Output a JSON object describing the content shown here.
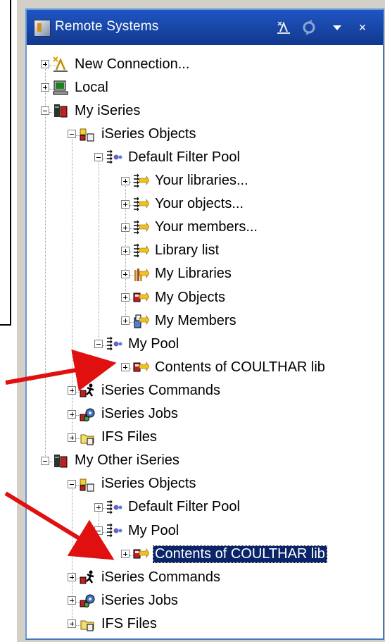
{
  "view": {
    "title": "Remote Systems",
    "toolbar": {
      "new_connection_icon": "new-connection-icon",
      "refresh_icon": "link-refresh-icon",
      "menu_icon": "view-menu-icon",
      "close_glyph": "×"
    }
  },
  "tree": [
    {
      "label": "New Connection...",
      "depth": 0,
      "expander": "plus",
      "icon": "new-connection-icon"
    },
    {
      "label": "Local",
      "depth": 0,
      "expander": "plus",
      "icon": "local-system-icon"
    },
    {
      "label": "My iSeries",
      "depth": 0,
      "expander": "minus",
      "icon": "iseries-system-icon"
    },
    {
      "label": "iSeries Objects",
      "depth": 1,
      "expander": "minus",
      "icon": "iseries-objects-icon"
    },
    {
      "label": "Default Filter Pool",
      "depth": 2,
      "expander": "minus",
      "icon": "filter-pool-icon"
    },
    {
      "label": "Your libraries...",
      "depth": 3,
      "expander": "plus",
      "icon": "filter-icon"
    },
    {
      "label": "Your objects...",
      "depth": 3,
      "expander": "plus",
      "icon": "filter-icon"
    },
    {
      "label": "Your members...",
      "depth": 3,
      "expander": "plus",
      "icon": "filter-icon"
    },
    {
      "label": "Library list",
      "depth": 3,
      "expander": "plus",
      "icon": "filter-icon"
    },
    {
      "label": "My Libraries",
      "depth": 3,
      "expander": "plus",
      "icon": "library-filter-icon"
    },
    {
      "label": "My Objects",
      "depth": 3,
      "expander": "plus",
      "icon": "object-filter-icon"
    },
    {
      "label": "My Members",
      "depth": 3,
      "expander": "plus",
      "icon": "member-filter-icon"
    },
    {
      "label": "My Pool",
      "depth": 2,
      "expander": "minus",
      "icon": "filter-pool-icon"
    },
    {
      "label": "Contents of COULTHAR lib",
      "depth": 3,
      "expander": "plus",
      "icon": "object-filter-icon"
    },
    {
      "label": "iSeries Commands",
      "depth": 1,
      "expander": "plus",
      "icon": "iseries-commands-icon"
    },
    {
      "label": "iSeries Jobs",
      "depth": 1,
      "expander": "plus",
      "icon": "iseries-jobs-icon"
    },
    {
      "label": "IFS Files",
      "depth": 1,
      "expander": "plus",
      "icon": "ifs-files-icon"
    },
    {
      "label": "My Other iSeries",
      "depth": 0,
      "expander": "minus",
      "icon": "iseries-system-icon"
    },
    {
      "label": "iSeries Objects",
      "depth": 1,
      "expander": "minus",
      "icon": "iseries-objects-icon"
    },
    {
      "label": "Default Filter Pool",
      "depth": 2,
      "expander": "plus",
      "icon": "filter-pool-icon"
    },
    {
      "label": "My Pool",
      "depth": 2,
      "expander": "minus",
      "icon": "filter-pool-icon"
    },
    {
      "label": "Contents of COULTHAR lib",
      "depth": 3,
      "expander": "plus",
      "icon": "object-filter-icon",
      "selected": true
    },
    {
      "label": "iSeries Commands",
      "depth": 1,
      "expander": "plus",
      "icon": "iseries-commands-icon"
    },
    {
      "label": "iSeries Jobs",
      "depth": 1,
      "expander": "plus",
      "icon": "iseries-jobs-icon"
    },
    {
      "label": "IFS Files",
      "depth": 1,
      "expander": "plus",
      "icon": "ifs-files-icon"
    }
  ],
  "colors": {
    "title_bar": "#1f55c2",
    "selection": "#0a246a",
    "annotation_arrow": "#e01010"
  }
}
